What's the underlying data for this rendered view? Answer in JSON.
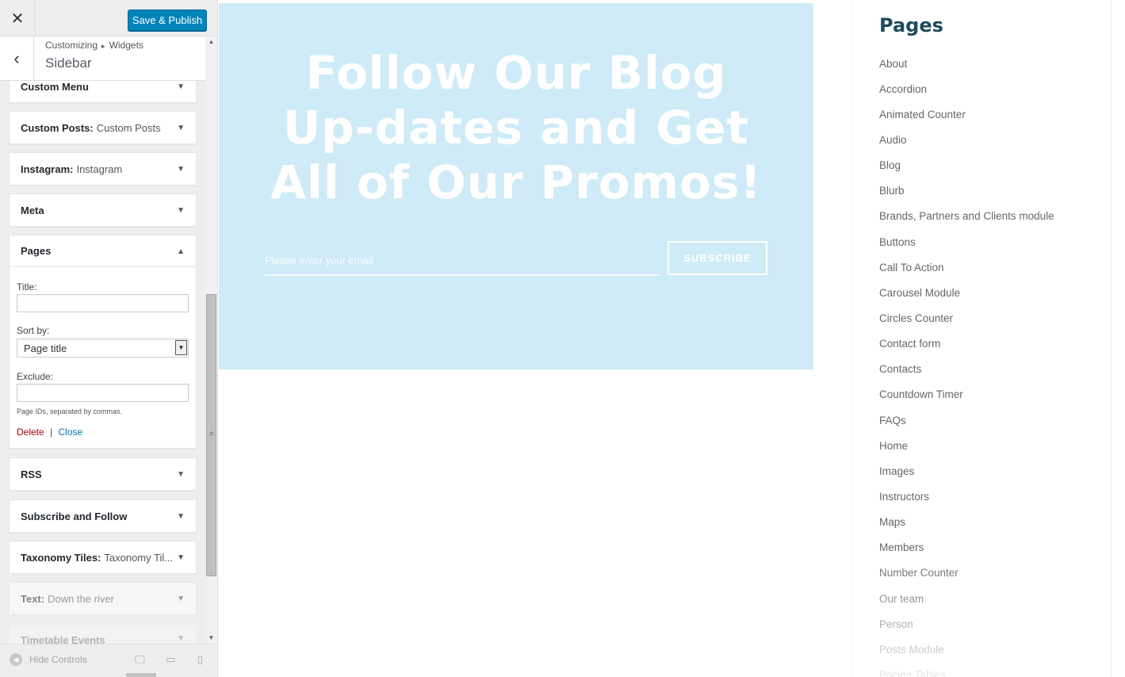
{
  "topbar": {
    "close_glyph": "✕",
    "save_label": "Save & Publish"
  },
  "section": {
    "breadcrumb_root": "Customizing",
    "breadcrumb_sep": "▸",
    "breadcrumb_child": "Widgets",
    "title": "Sidebar",
    "back_glyph": "‹"
  },
  "widgets": {
    "custom_menu": "Custom Menu",
    "custom_posts_label": "Custom Posts:",
    "custom_posts_sub": "Custom Posts",
    "instagram_label": "Instagram:",
    "instagram_sub": "Instagram",
    "meta": "Meta",
    "pages": "Pages",
    "rss": "RSS",
    "subscribe_follow": "Subscribe and Follow",
    "taxonomy_label": "Taxonomy Tiles:",
    "taxonomy_sub": "Taxonomy Til...",
    "text_label": "Text:",
    "text_sub": "Down the river",
    "timetable": "Timetable Events"
  },
  "pages_form": {
    "title_label": "Title:",
    "title_value": "",
    "sort_label": "Sort by:",
    "sort_value": "Page title",
    "exclude_label": "Exclude:",
    "exclude_value": "",
    "help_text": "Page IDs, separated by commas.",
    "delete_label": "Delete",
    "separator": "|",
    "close_label": "Close"
  },
  "footer": {
    "hide_controls": "Hide Controls"
  },
  "preview": {
    "promo_heading": "Follow Our Blog Up-dates and Get All of Our Promos!",
    "email_placeholder": "Please enter your email",
    "subscribe_label": "SUBSCRIBE",
    "pages_title": "Pages",
    "pages_items": [
      "About",
      "Accordion",
      "Animated Counter",
      "Audio",
      "Blog",
      "Blurb",
      "Brands, Partners and Clients module",
      "Buttons",
      "Call To Action",
      "Carousel Module",
      "Circles Counter",
      "Contact form",
      "Contacts",
      "Countdown Timer",
      "FAQs",
      "Home",
      "Images",
      "Instructors",
      "Maps",
      "Members",
      "Number Counter",
      "Our team",
      "Person",
      "Posts Module",
      "Pricing Tables"
    ]
  },
  "colors": {
    "primary_button": "#0085ba",
    "promo_bg": "#ceebf7",
    "pages_title": "#1e4a5d",
    "delete_link": "#a00000",
    "close_link": "#0073aa"
  }
}
